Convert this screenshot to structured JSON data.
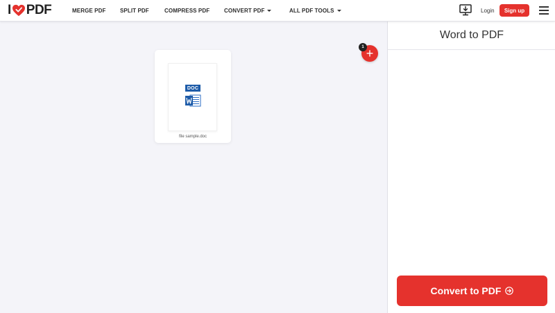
{
  "header": {
    "logo_i": "I",
    "logo_pdf": "PDF",
    "nav": {
      "merge": "MERGE PDF",
      "split": "SPLIT PDF",
      "compress": "COMPRESS PDF",
      "convert": "CONVERT PDF",
      "all_tools": "ALL PDF TOOLS"
    },
    "login": "Login",
    "signup": "Sign up"
  },
  "workspace": {
    "file": {
      "badge": "DOC",
      "name": "file sample.doc"
    },
    "add_button": {
      "label": "+",
      "count": "1"
    }
  },
  "sidebar": {
    "title": "Word to PDF",
    "convert_label": "Convert to PDF"
  },
  "colors": {
    "accent": "#e5322d",
    "word_blue": "#1d5ba8",
    "background": "#f4f4f9"
  },
  "icons": {
    "logo": "heart-icon",
    "desktop": "desktop-download-icon",
    "menu": "hamburger-menu-icon",
    "file": "word-document-icon",
    "convert": "arrow-circle-right-icon"
  }
}
